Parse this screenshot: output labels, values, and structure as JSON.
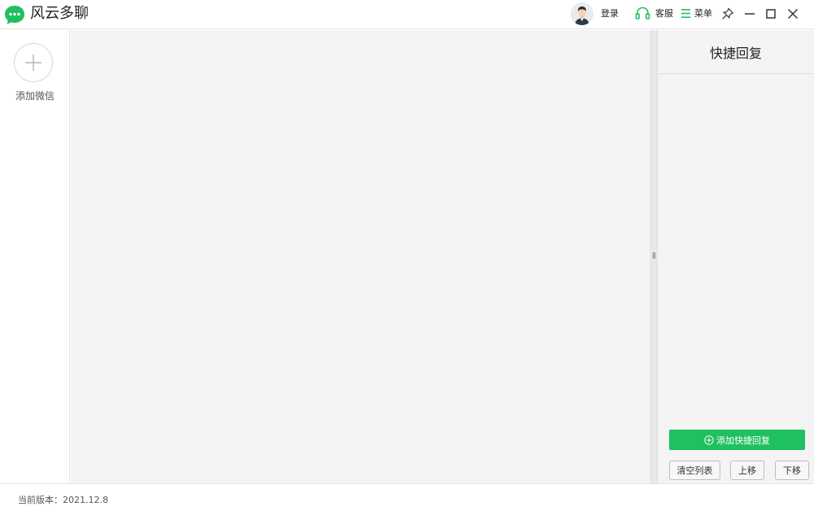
{
  "titlebar": {
    "app_title": "风云多聊",
    "login_label": "登录",
    "service_label": "客服",
    "menu_label": "菜单",
    "accent_color": "#1fc05f"
  },
  "left": {
    "add_wechat_label": "添加微信"
  },
  "quick_reply": {
    "title": "快捷回复",
    "add_button": "添加快捷回复",
    "clear_button": "清空列表",
    "move_up_button": "上移",
    "move_down_button": "下移"
  },
  "status": {
    "version_text": "当前版本：2021.12.8"
  }
}
